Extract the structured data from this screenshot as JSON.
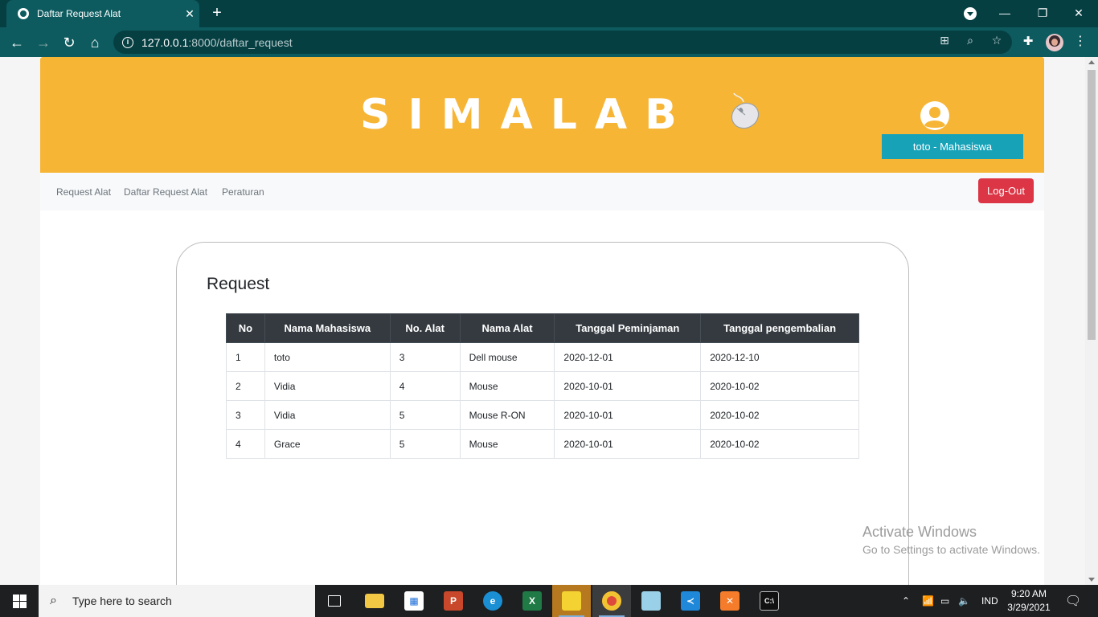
{
  "browser": {
    "tab_title": "Daftar Request Alat",
    "tab_close": "✕",
    "new_tab": "+",
    "url_host": "127.0.0.1",
    "url_path": ":8000/daftar_request",
    "minimize": "—",
    "restore": "❐",
    "close": "✕"
  },
  "header": {
    "brand": "SIMALAB",
    "user_badge": "toto - Mahasiswa"
  },
  "subnav": {
    "links": [
      "Request Alat",
      "Daftar Request Alat",
      "Peraturan"
    ],
    "logout": "Log-Out"
  },
  "card": {
    "title": "Request",
    "columns": [
      "No",
      "Nama Mahasiswa",
      "No. Alat",
      "Nama Alat",
      "Tanggal Peminjaman",
      "Tanggal pengembalian"
    ],
    "rows": [
      [
        "1",
        "toto",
        "3",
        "Dell mouse",
        "2020-12-01",
        "2020-12-10"
      ],
      [
        "2",
        "Vidia",
        "4",
        "Mouse",
        "2020-10-01",
        "2020-10-02"
      ],
      [
        "3",
        "Vidia",
        "5",
        "Mouse R-ON",
        "2020-10-01",
        "2020-10-02"
      ],
      [
        "4",
        "Grace",
        "5",
        "Mouse",
        "2020-10-01",
        "2020-10-02"
      ]
    ]
  },
  "watermark": {
    "line1": "Activate Windows",
    "line2": "Go to Settings to activate Windows."
  },
  "taskbar": {
    "search_placeholder": "Type here to search",
    "lang": "IND",
    "time": "9:20 AM",
    "date": "3/29/2021"
  },
  "colors": {
    "header_bg": "#f7b535",
    "badge_bg": "#17a2b8",
    "logout_bg": "#dc3545",
    "table_head_bg": "#343a40",
    "chrome_bg": "#0d5b5f"
  }
}
